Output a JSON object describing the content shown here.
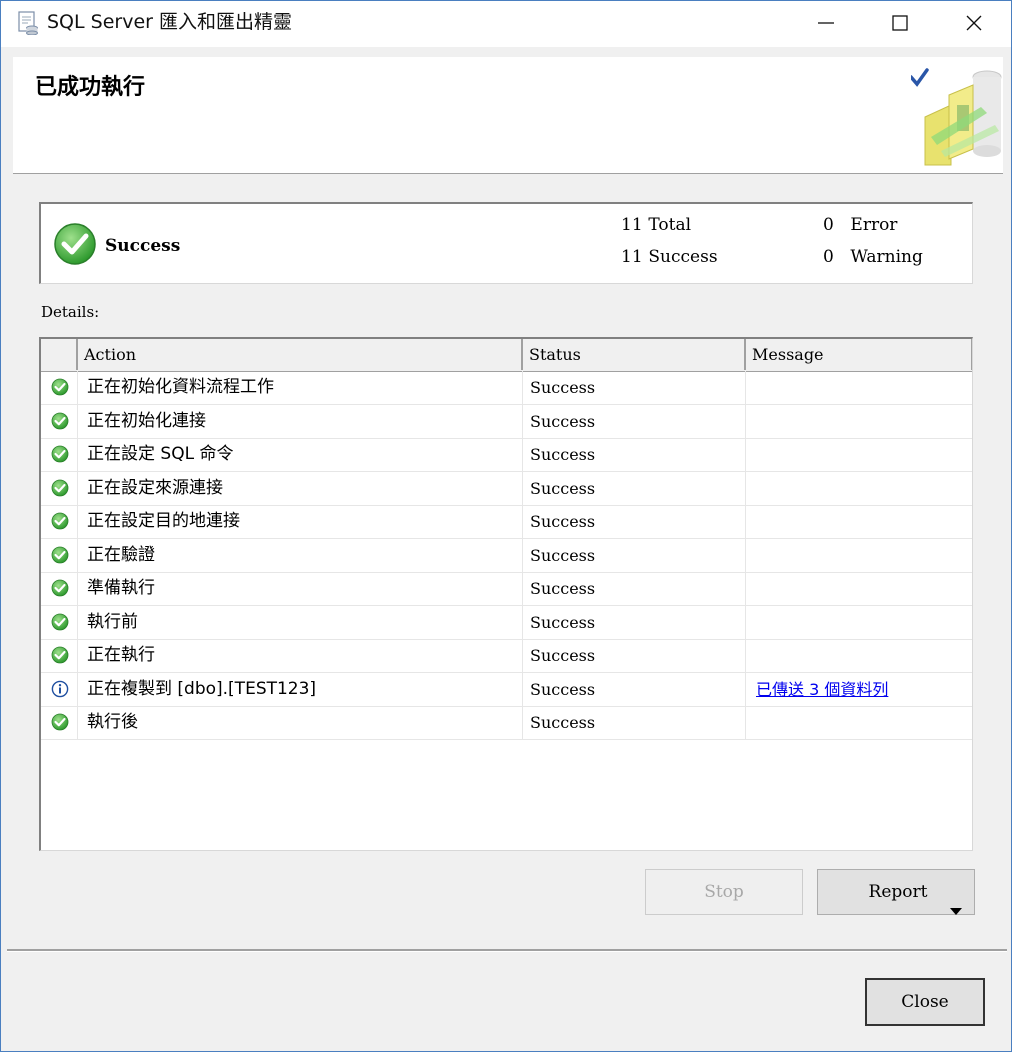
{
  "window": {
    "title": "SQL Server 匯入和匯出精靈",
    "icon": "wizard-app-icon"
  },
  "header": {
    "title": "已成功執行",
    "graphic": "wizard-checkmark-graphic"
  },
  "summary": {
    "status": "Success",
    "total_count": "11",
    "total_label": "Total",
    "success_count": "11",
    "success_label": "Success",
    "error_count": "0",
    "error_label": "Error",
    "warning_count": "0",
    "warning_label": "Warning"
  },
  "details_label": "Details:",
  "grid": {
    "columns": [
      "Action",
      "Status",
      "Message"
    ],
    "rows": [
      {
        "icon": "success-icon",
        "action": "正在初始化資料流程工作",
        "status": "Success",
        "message": ""
      },
      {
        "icon": "success-icon",
        "action": "正在初始化連接",
        "status": "Success",
        "message": ""
      },
      {
        "icon": "success-icon",
        "action": "正在設定 SQL 命令",
        "status": "Success",
        "message": ""
      },
      {
        "icon": "success-icon",
        "action": "正在設定來源連接",
        "status": "Success",
        "message": ""
      },
      {
        "icon": "success-icon",
        "action": "正在設定目的地連接",
        "status": "Success",
        "message": ""
      },
      {
        "icon": "success-icon",
        "action": "正在驗證",
        "status": "Success",
        "message": ""
      },
      {
        "icon": "success-icon",
        "action": "準備執行",
        "status": "Success",
        "message": ""
      },
      {
        "icon": "success-icon",
        "action": "執行前",
        "status": "Success",
        "message": ""
      },
      {
        "icon": "success-icon",
        "action": "正在執行",
        "status": "Success",
        "message": ""
      },
      {
        "icon": "info-icon",
        "action": "正在複製到 [dbo].[TEST123]",
        "status": "Success",
        "message": "已傳送 3 個資料列"
      },
      {
        "icon": "success-icon",
        "action": "執行後",
        "status": "Success",
        "message": ""
      }
    ]
  },
  "buttons": {
    "stop": "Stop",
    "report": "Report",
    "close": "Close"
  },
  "colors": {
    "accent": "#4a7fc0",
    "success_green": "#3aa53a",
    "info_blue": "#1f4fa0",
    "link": "#0000ee"
  }
}
